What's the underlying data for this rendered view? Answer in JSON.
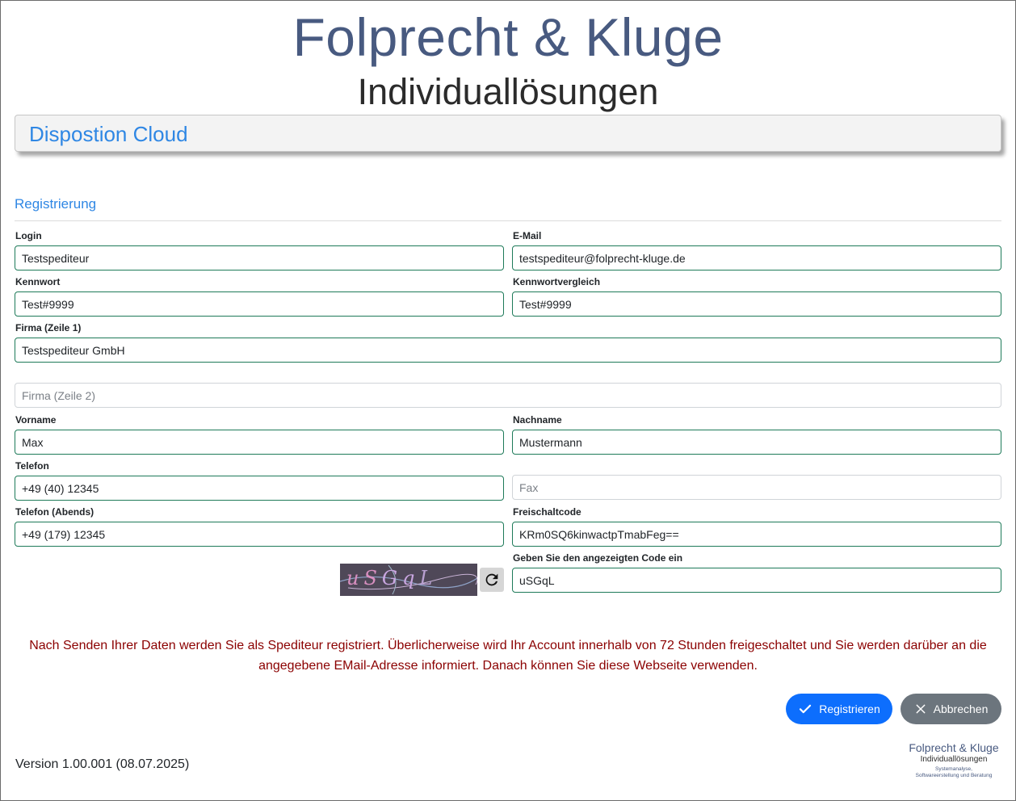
{
  "header": {
    "brand_line1": "Folprecht & Kluge",
    "brand_line2": "Individuallösungen",
    "banner_title": "Dispostion Cloud"
  },
  "form": {
    "section_title": "Registrierung",
    "login": {
      "label": "Login",
      "value": "Testspediteur"
    },
    "email": {
      "label": "E-Mail",
      "value": "testspediteur@folprecht-kluge.de"
    },
    "password": {
      "label": "Kennwort",
      "value": "Test#9999"
    },
    "password_confirm": {
      "label": "Kennwortvergleich",
      "value": "Test#9999"
    },
    "company1": {
      "label": "Firma (Zeile 1)",
      "value": "Testspediteur GmbH"
    },
    "company2": {
      "placeholder": "Firma (Zeile 2)",
      "value": ""
    },
    "first_name": {
      "label": "Vorname",
      "value": "Max"
    },
    "last_name": {
      "label": "Nachname",
      "value": "Mustermann"
    },
    "phone": {
      "label": "Telefon",
      "value": "+49 (40) 12345"
    },
    "fax": {
      "placeholder": "Fax",
      "value": ""
    },
    "phone_evening": {
      "label": "Telefon (Abends)",
      "value": "+49 (179) 12345"
    },
    "unlock_code": {
      "label": "Freischaltcode",
      "value": "KRm0SQ6kinwactpTmabFeg=="
    },
    "captcha": {
      "label": "Geben Sie den angezeigten Code ein",
      "value": "uSGqL",
      "image_text": "uSGqL",
      "refresh_icon": "refresh-icon"
    }
  },
  "notice": "Nach Senden Ihrer Daten werden Sie als Spediteur registriert. Überlicherweise wird Ihr Account innerhalb von 72 Stunden freigeschaltet und Sie werden darüber an die angegebene EMail-Adresse informiert. Danach können Sie diese Webseite verwenden.",
  "buttons": {
    "register": {
      "label": "Registrieren",
      "icon": "check-icon",
      "color": "#0d6efd"
    },
    "cancel": {
      "label": "Abbrechen",
      "icon": "close-icon",
      "color": "#6c757d"
    }
  },
  "footer": {
    "version": "Version 1.00.001 (08.07.2025)",
    "logo_line1": "Folprecht & Kluge",
    "logo_line2": "Individuallösungen",
    "logo_line3": "Systemanalyse,",
    "logo_line4": "Softwareerstellung und Beratung"
  },
  "colors": {
    "accent": "#2f87e4",
    "brand": "#485a80",
    "input_border": "#1e7a59",
    "notice": "#8b0000"
  }
}
